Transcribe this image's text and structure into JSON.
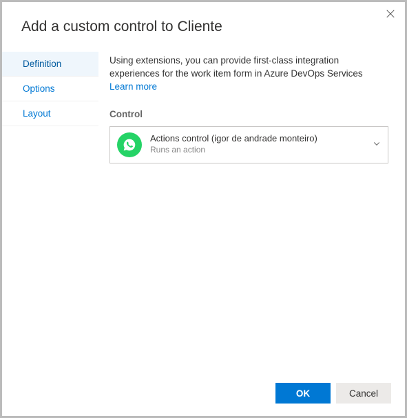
{
  "dialog": {
    "title": "Add a custom control to Cliente"
  },
  "sidebar": {
    "items": [
      {
        "label": "Definition",
        "active": true
      },
      {
        "label": "Options",
        "active": false
      },
      {
        "label": "Layout",
        "active": false
      }
    ]
  },
  "main": {
    "description": "Using extensions, you can provide first-class integration experiences for the work item form in Azure DevOps Services ",
    "learn_more": "Learn more",
    "section_label": "Control",
    "selected_control": {
      "title": "Actions control (igor de andrade monteiro)",
      "subtitle": "Runs an action"
    }
  },
  "footer": {
    "ok": "OK",
    "cancel": "Cancel"
  }
}
